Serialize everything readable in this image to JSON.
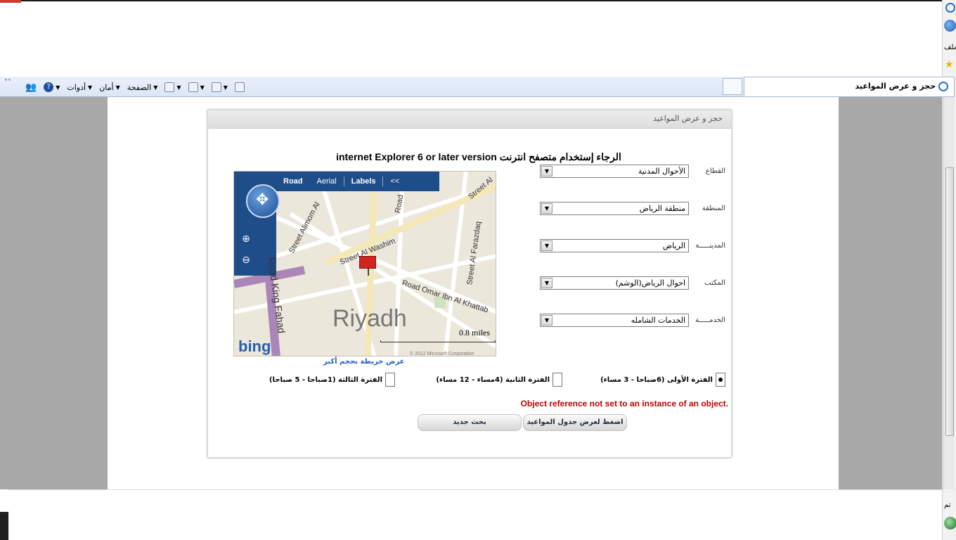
{
  "browser": {
    "tab_title": "حجز و عرض المواعيد",
    "commands": {
      "page": "الصفحة",
      "safety": "أمان",
      "tools": "أدوات"
    },
    "side_label": "ملف",
    "bottom_side_label": "تم"
  },
  "panel": {
    "header": "حجز و عرض المواعيد",
    "notice": "الرجاء إستخدام متصفح انترنت internet Explorer 6 or later version"
  },
  "form": {
    "fields": [
      {
        "label": "القطاع",
        "value": "الأحوال المدنية"
      },
      {
        "label": "المنطقة",
        "value": "منطقة الرياض"
      },
      {
        "label": "المدينـــــة",
        "value": "الرياض"
      },
      {
        "label": "المكتب",
        "value": "احوال الرياض(الوشم)"
      },
      {
        "label": "الخدمـــــة",
        "value": "الخدمات الشامله"
      }
    ]
  },
  "map": {
    "modes": {
      "road": "Road",
      "aerial": "Aerial",
      "labels": "Labels",
      "collapse": "<<"
    },
    "city": "Riyadh",
    "scale": "0.8 miles",
    "brand": "bing",
    "copyright": "© 2012 Microsoft Corporation",
    "streets": {
      "alimom": "Street Alimom Al",
      "washim": "Street Al Washim",
      "omar": "Road Omar Ibn Al Khattab",
      "farazdaq": "Street Al Farazdaq",
      "king_fahad": "Road King Fahad",
      "street_al": "Street Al",
      "road": "Road"
    },
    "bigger_map_link": "عرض خريطة بحجم أكبر"
  },
  "periods": [
    {
      "label": "الفترة الأولى (6صباحا - 3 مساء)",
      "checked": true
    },
    {
      "label": "الفترة الثانية (4مساء - 12 مساء)",
      "checked": false
    },
    {
      "label": "الفترة الثالثة (1صباحا - 5 صباحا)",
      "checked": false
    }
  ],
  "error": "Object reference not set to an instance of an object.",
  "buttons": {
    "show_schedule": "اضغط لعرض جدول المواعيد",
    "new_search": "بحث جديد"
  }
}
